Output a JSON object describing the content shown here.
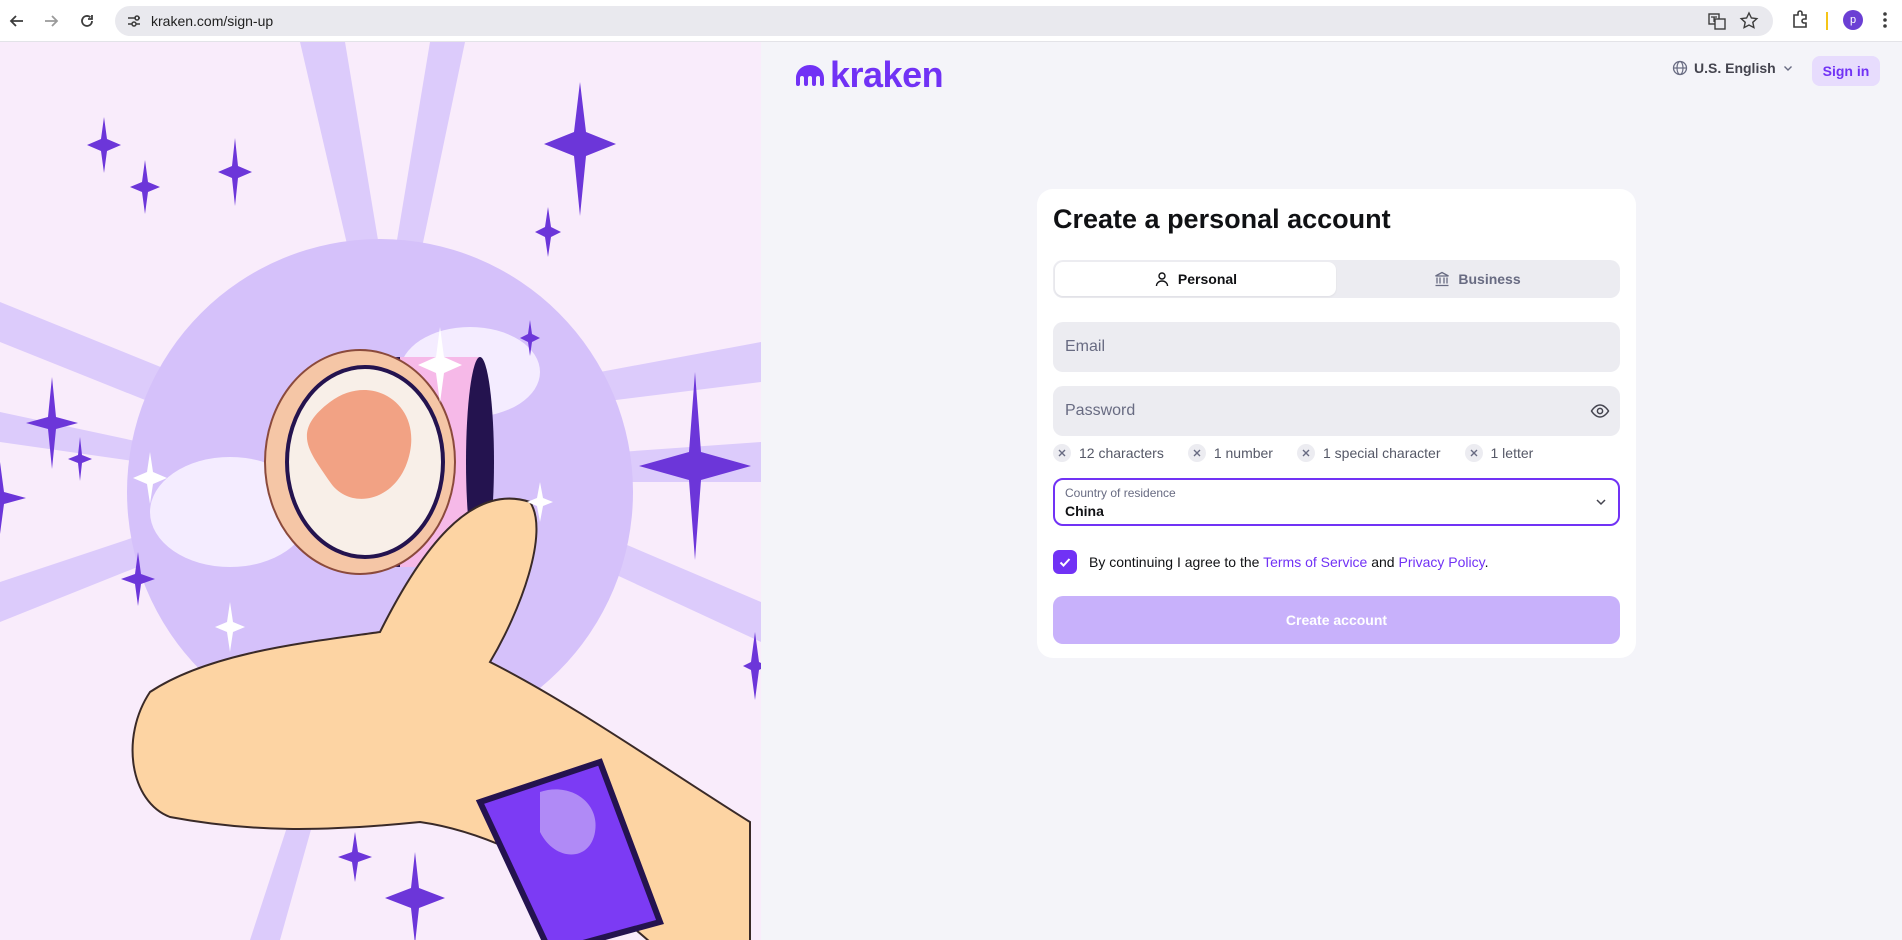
{
  "browser": {
    "url": "kraken.com/sign-up",
    "profile_initial": "p"
  },
  "header": {
    "logo_text": "kraken",
    "language": "U.S. English",
    "sign_in": "Sign in"
  },
  "form": {
    "title": "Create a personal account",
    "tabs": [
      {
        "label": "Personal",
        "icon": "user-icon",
        "active": true
      },
      {
        "label": "Business",
        "icon": "bank-icon",
        "active": false
      }
    ],
    "email": {
      "placeholder": "Email",
      "value": ""
    },
    "password": {
      "placeholder": "Password",
      "value": ""
    },
    "requirements": [
      "12 characters",
      "1 number",
      "1 special character",
      "1 letter"
    ],
    "country": {
      "label": "Country of residence",
      "value": "China"
    },
    "consent": {
      "checked": true,
      "prefix": "By continuing I agree to the",
      "terms": "Terms of Service",
      "and": "and",
      "privacy": "Privacy Policy",
      "suffix": "."
    },
    "submit": "Create account"
  },
  "colors": {
    "accent": "#7132f5",
    "accent_light": "#c8b1fb",
    "page_bg": "#f4f4f9",
    "illustration_bg": "#f9ecfb"
  }
}
